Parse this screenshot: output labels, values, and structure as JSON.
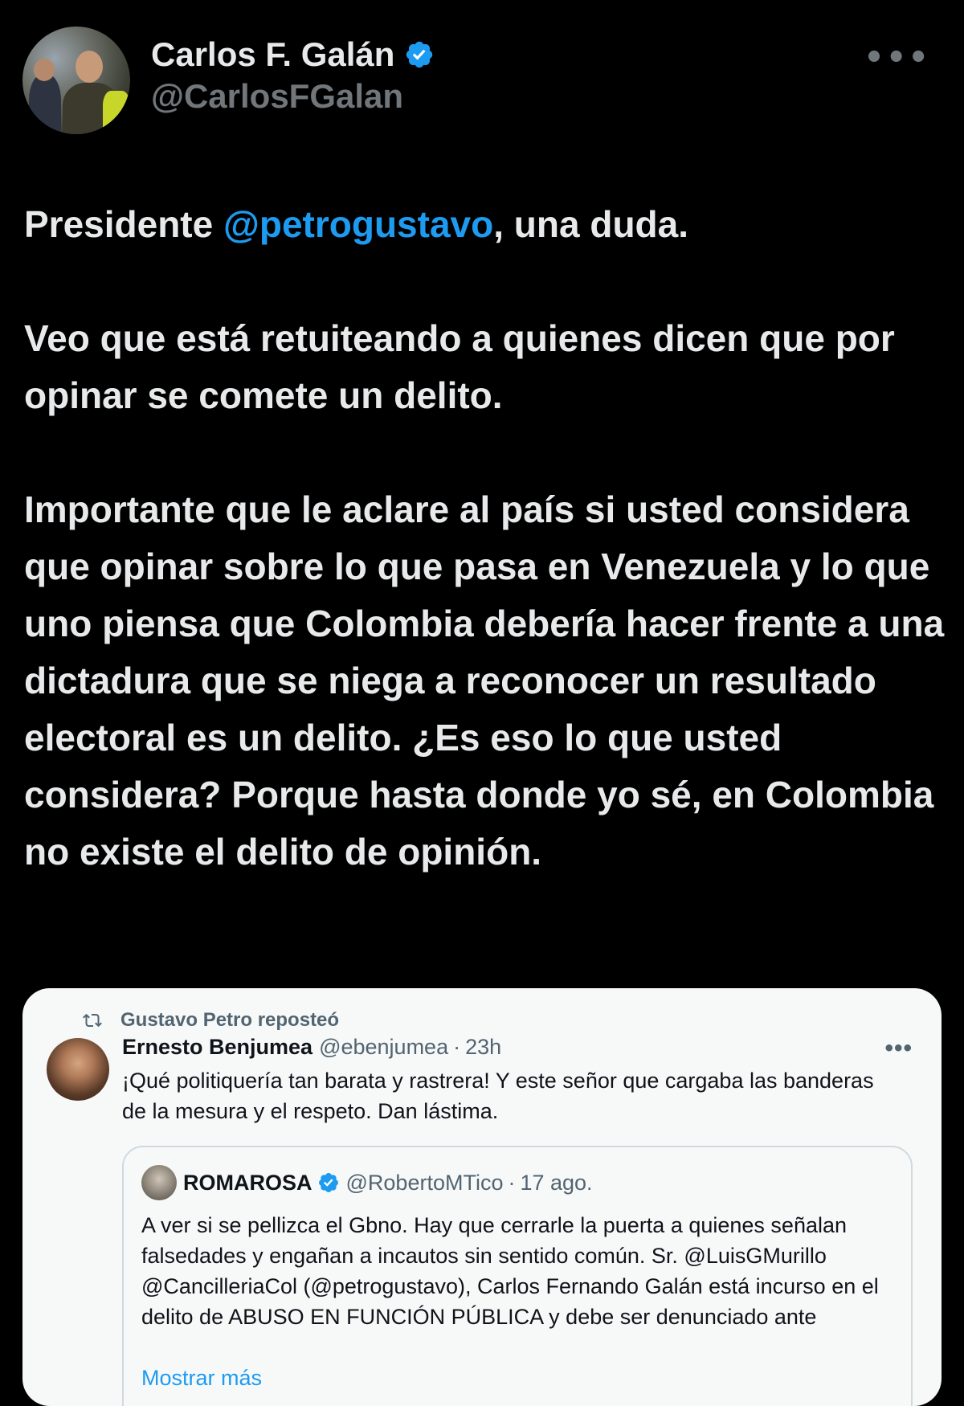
{
  "author": {
    "name": "Carlos F. Galán",
    "handle": "@CarlosFGalan"
  },
  "tweet": {
    "line1_pre": "Presidente ",
    "line1_mention": "@petrogustavo",
    "line1_post": ", una duda.",
    "para2": "Veo que está retuiteando a quienes dicen que por opinar se comete un delito.",
    "para3": "Importante que le aclare al país si usted considera que opinar sobre lo que pasa en Venezuela y lo que uno piensa que Colombia debería hacer frente a una dictadura que se niega a reconocer un resultado electoral es un delito. ¿Es eso lo que usted considera? Porque hasta donde yo sé, en Colombia no existe el delito de opinión."
  },
  "embedded": {
    "repost_label": "Gustavo Petro reposteó",
    "name": "Ernesto Benjumea",
    "handle": "@ebenjumea",
    "dot": "·",
    "time": "23h",
    "text": "¡Qué politiquería tan barata y rastrera! Y este señor que cargaba las banderas de la mesura y el respeto. Dan lástima.",
    "quote": {
      "name": "ROMAROSA",
      "handle": "@RobertoMTico",
      "dot": "·",
      "time": "17 ago.",
      "text": "A ver si se pellizca el Gbno. Hay que cerrarle la puerta a quienes señalan falsedades y engañan a incautos sin sentido común. Sr. @LuisGMurillo @CancilleriaCol (@petrogustavo), Carlos Fernando Galán está incurso en el delito de ABUSO EN FUNCIÓN PÚBLICA y debe ser denunciado ante",
      "show_more": "Mostrar más"
    }
  },
  "icons": {
    "more": "more-horizontal-icon",
    "verified": "verified-badge-icon",
    "repost": "repost-icon"
  },
  "colors": {
    "background": "#000000",
    "text": "#e7e9ea",
    "secondary": "#71767b",
    "accent": "#1d9bf0",
    "card": "#f7f9f9"
  }
}
